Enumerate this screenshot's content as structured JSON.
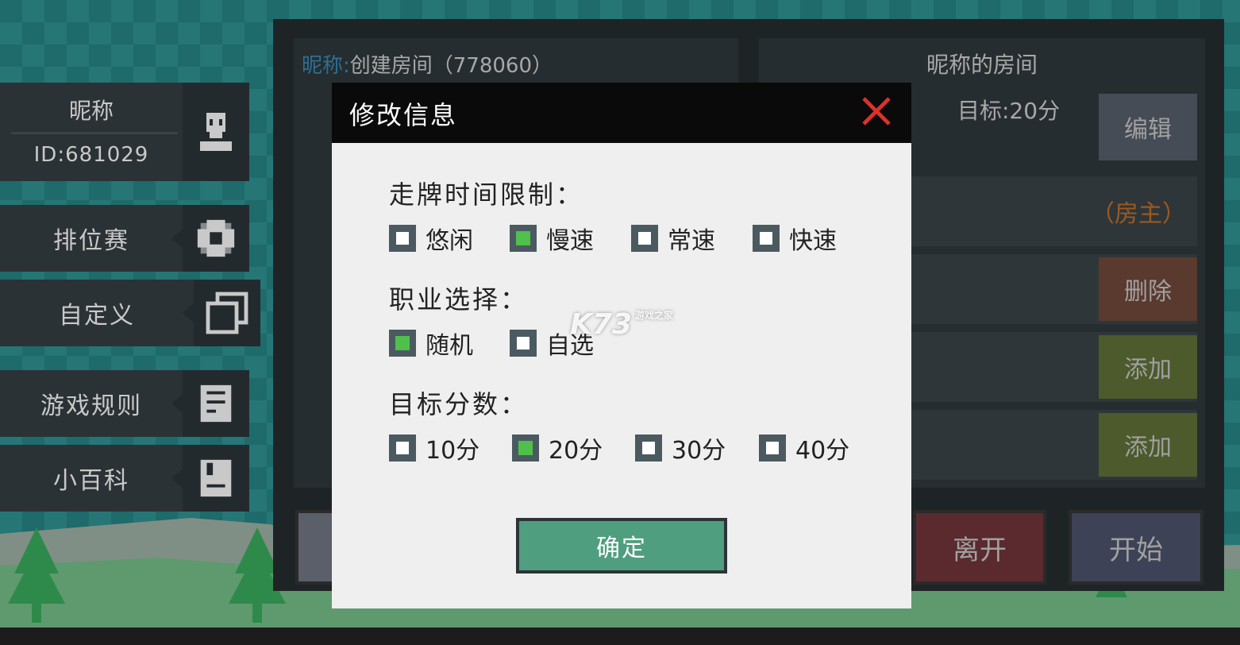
{
  "profile": {
    "nickname": "昵称",
    "id_text": "ID:681029"
  },
  "side_menu": [
    {
      "label": "排位赛",
      "icon": "gear-icon"
    },
    {
      "label": "自定义",
      "icon": "copy-icon"
    },
    {
      "label": "游戏规则",
      "icon": "document-icon"
    },
    {
      "label": "小百科",
      "icon": "book-icon"
    }
  ],
  "room": {
    "left_title_key": "昵称:",
    "left_title_value": "创建房间（778060）",
    "right_title": "昵称的房间",
    "target": "目标:20分",
    "edit_label": "编辑",
    "host_tag": "（房主）",
    "delete_label": "删除",
    "add_label_1": "添加",
    "add_label_2": "添加",
    "leave_label": "离开",
    "start_label": "开始"
  },
  "modal": {
    "title": "修改信息",
    "sections": [
      {
        "title": "走牌时间限制：",
        "options": [
          {
            "label": "悠闲",
            "checked": false
          },
          {
            "label": "慢速",
            "checked": true
          },
          {
            "label": "常速",
            "checked": false
          },
          {
            "label": "快速",
            "checked": false
          }
        ]
      },
      {
        "title": "职业选择：",
        "options": [
          {
            "label": "随机",
            "checked": true
          },
          {
            "label": "自选",
            "checked": false
          }
        ]
      },
      {
        "title": "目标分数：",
        "options": [
          {
            "label": "10分",
            "checked": false
          },
          {
            "label": "20分",
            "checked": true
          },
          {
            "label": "30分",
            "checked": false
          },
          {
            "label": "40分",
            "checked": false
          }
        ]
      }
    ],
    "confirm_label": "确定"
  },
  "watermark": {
    "text": "K73",
    "sub": "游戏之家"
  },
  "colors": {
    "accent_green": "#4fc04a",
    "confirm_bg": "#4f9e7f",
    "close_red": "#e0302a"
  }
}
